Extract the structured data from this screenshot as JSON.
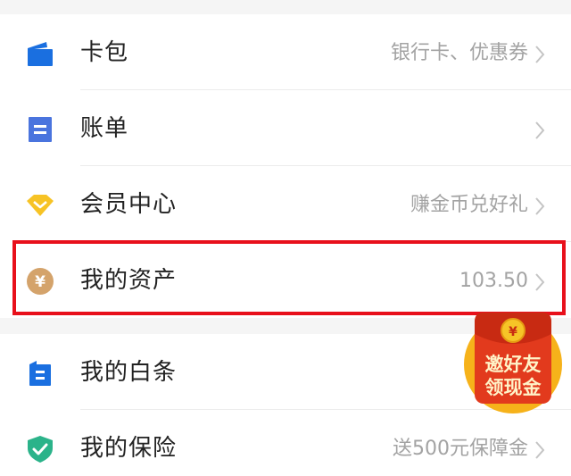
{
  "menu": {
    "wallet": {
      "label": "卡包",
      "value": "银行卡、优惠券"
    },
    "bill": {
      "label": "账单",
      "value": ""
    },
    "member": {
      "label": "会员中心",
      "value": "赚金币兑好礼"
    },
    "assets": {
      "label": "我的资产",
      "value": "103.50"
    },
    "baitiao": {
      "label": "我的白条",
      "value": ""
    },
    "insurance": {
      "label": "我的保险",
      "value": "送500元保障金"
    }
  },
  "promo": {
    "line1": "邀好友",
    "line2": "领现金",
    "coin_symbol": "¥"
  },
  "colors": {
    "highlight": "#e8101b",
    "wallet_icon": "#1a6fe0",
    "bill_icon": "#4a74de",
    "member_icon": "#f7c325",
    "assets_icon": "#d4a36b",
    "baitiao_icon": "#1a6fe0",
    "insurance_icon": "#2bb38a"
  }
}
